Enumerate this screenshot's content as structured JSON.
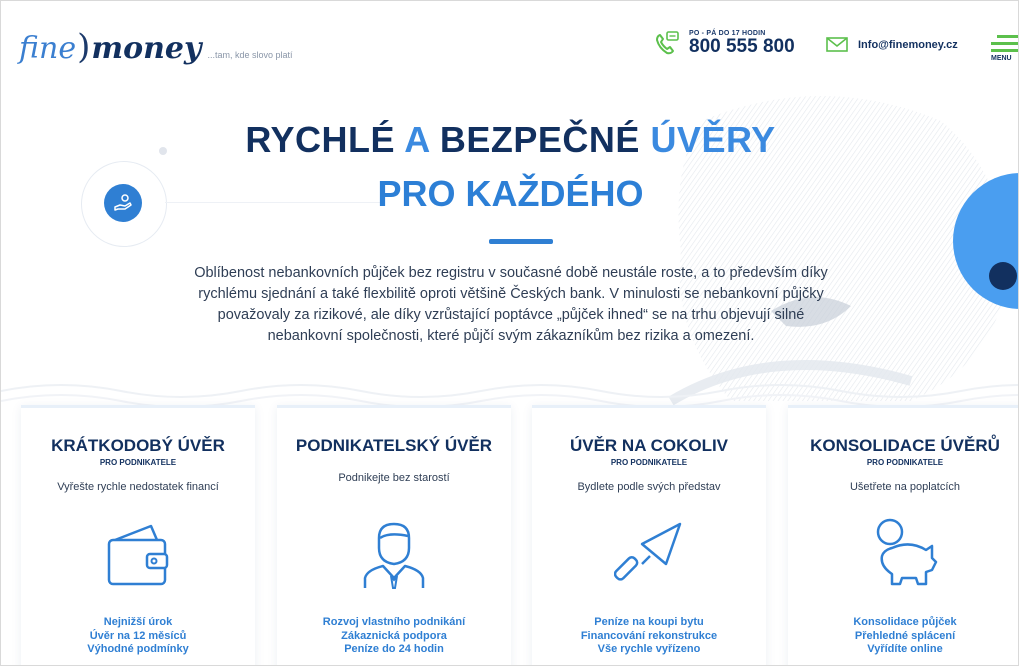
{
  "header": {
    "logo_fine": "fine",
    "logo_paren": ")",
    "logo_money": "money",
    "tagline": "...tam, kde slovo platí",
    "phone_hours": "PO - PÁ DO 17 HODIN",
    "phone_number": "800 555 800",
    "email": "Info@finemoney.cz",
    "menu_label": "MENU"
  },
  "hero": {
    "title_part1": "RYCHLÉ",
    "title_part2": "A",
    "title_part3": "BEZPEČNÉ",
    "title_part4": "ÚVĚRY",
    "title_line2": "PRO KAŽDÉHO",
    "intro": "Oblíbenost nebankovních půjček bez registru v současné době neustále roste, a to především díky rychlému sjednání a také flexbilitě oproti většině Českých bank. V minulosti se nebankovní půjčky považovaly za rizikové, ale díky vzrůstající poptávce „půjček ihned“ se na trhu objevují silné nebankovní společnosti, které půjčí svým zákazníkům bez rizika a omezení."
  },
  "cards": [
    {
      "title": "KRÁTKODOBÝ ÚVĚR",
      "sub": "PRO PODNIKATELE",
      "desc": "Vyřešte rychle nedostatek financí",
      "icon": "wallet-icon",
      "bullets": [
        "Nejnižší úrok",
        "Úvěr na 12 měsíců",
        "Výhodné podmínky"
      ]
    },
    {
      "title": "PODNIKATELSKÝ ÚVĚR",
      "sub": "",
      "desc": "Podnikejte bez starostí",
      "icon": "businessman-icon",
      "bullets": [
        "Rozvoj vlastního podnikání",
        "Zákaznická podpora",
        "Peníze do 24 hodin"
      ]
    },
    {
      "title": "ÚVĚR NA COKOLIV",
      "sub": "PRO PODNIKATELE",
      "desc": "Bydlete podle svých představ",
      "icon": "trowel-icon",
      "bullets": [
        "Peníze na koupi bytu",
        "Financování rekonstrukce",
        "Vše rychle vyřízeno"
      ]
    },
    {
      "title": "KONSOLIDACE ÚVĚRŮ",
      "sub": "PRO PODNIKATELE",
      "desc": "Ušetřete na poplatcích",
      "icon": "piggy-bank-icon",
      "bullets": [
        "Konsolidace půjček",
        "Přehledné splácení",
        "Vyřídíte online"
      ]
    }
  ],
  "colors": {
    "navy": "#12305f",
    "blue": "#2f7fd3",
    "green": "#5cc04c"
  }
}
